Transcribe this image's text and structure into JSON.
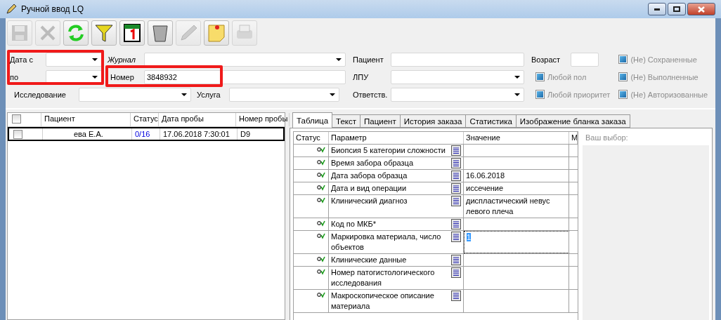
{
  "window": {
    "title": "Ручной ввод LQ"
  },
  "toolbar": [
    {
      "kind": "save",
      "disabled": true
    },
    {
      "kind": "delete",
      "disabled": true
    },
    {
      "kind": "refresh",
      "disabled": false
    },
    {
      "kind": "filter",
      "disabled": false
    },
    {
      "kind": "calendar",
      "disabled": false
    },
    {
      "kind": "trash",
      "disabled": false
    },
    {
      "kind": "pen",
      "disabled": true
    },
    {
      "kind": "note",
      "disabled": false
    },
    {
      "kind": "print",
      "disabled": true
    }
  ],
  "filters": {
    "date_from": {
      "label": "Дата с"
    },
    "date_to": {
      "label": "по"
    },
    "journal": {
      "label": "Журнал"
    },
    "number": {
      "label": "Номер",
      "value": "3848932"
    },
    "study": {
      "label": "Исследование"
    },
    "service": {
      "label": "Услуга"
    },
    "patient": {
      "label": "Пациент"
    },
    "lpu": {
      "label": "ЛПУ"
    },
    "responsible": {
      "label": "Ответств."
    },
    "age": {
      "label": "Возраст"
    }
  },
  "checkboxes": [
    {
      "label": "(Не) Сохраненные",
      "checked": true,
      "disabled": true
    },
    {
      "label": "Любой пол",
      "checked": true,
      "disabled": true
    },
    {
      "label": "(Не) Выполненные",
      "checked": true,
      "disabled": true
    },
    {
      "label": "Любой приоритет",
      "checked": true,
      "disabled": true
    },
    {
      "label": "(Не) Авторизованные",
      "checked": true,
      "disabled": true
    }
  ],
  "list": {
    "columns": [
      "Пациент",
      "Статус",
      "Дата пробы",
      "Номер пробы"
    ],
    "all_checked": false,
    "rows": [
      {
        "checked": false,
        "selected": true,
        "cells": [
          "ева Е.А.",
          "0/16",
          "17.06.2018 7:30:01",
          "D9"
        ]
      }
    ]
  },
  "tabs": [
    {
      "label": "Таблица",
      "selected": true
    },
    {
      "label": "Текст",
      "selected": false
    },
    {
      "label": "Пациент",
      "selected": false
    },
    {
      "label": "История заказа",
      "selected": false
    },
    {
      "label": "Статистика",
      "selected": false
    },
    {
      "label": "Изображение бланка заказа",
      "selected": false
    }
  ],
  "grid": {
    "columns": [
      "Статус",
      "Параметр",
      "Значение",
      "М"
    ],
    "rows": [
      {
        "parameter": "Биопсия 5 категории сложности",
        "value": "",
        "focused": false
      },
      {
        "parameter": "Время забора образца",
        "value": "",
        "focused": false
      },
      {
        "parameter": "Дата забора образца",
        "value": "16.06.2018",
        "focused": false
      },
      {
        "parameter": "Дата и вид операции",
        "value": "иссечение",
        "focused": false
      },
      {
        "parameter": "Клинический диагноз",
        "value": "диспластический невус левого плеча",
        "focused": false
      },
      {
        "parameter": "Код по МКБ*",
        "value": "",
        "focused": false
      },
      {
        "parameter": "Маркировка материала, число объектов",
        "value": "1",
        "focused": true
      },
      {
        "parameter": "Клинические данные",
        "value": "",
        "focused": false
      },
      {
        "parameter": "Номер патогистологического исследования",
        "value": "",
        "focused": false
      },
      {
        "parameter": "Макроскопическое описание материала",
        "value": "",
        "focused": false
      }
    ]
  },
  "choice": {
    "label": "Ваш выбор:"
  }
}
